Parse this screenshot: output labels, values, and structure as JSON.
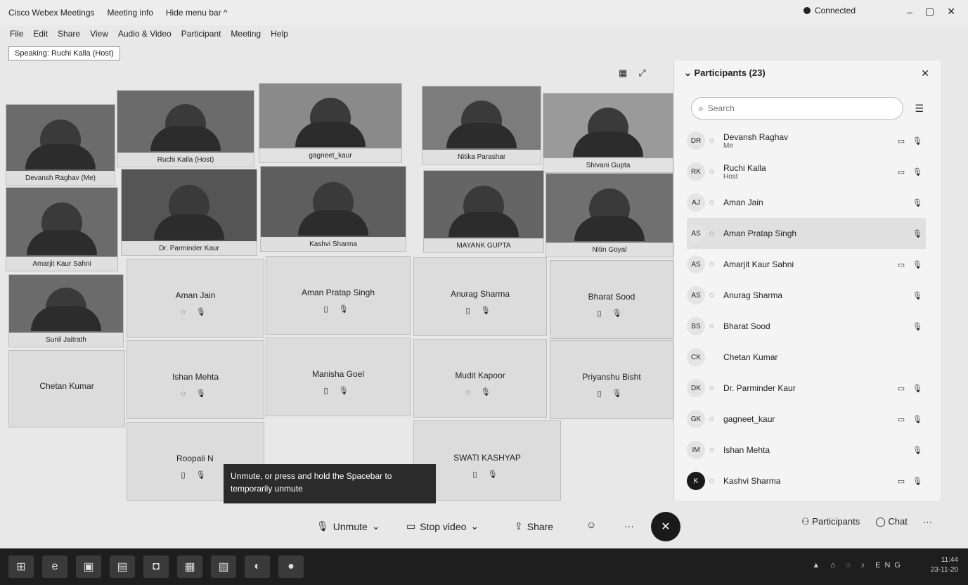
{
  "topbar": {
    "app_name": "Cisco Webex Meetings",
    "meeting_info": "Meeting info",
    "hide_menu_bar": "Hide menu bar ^",
    "connected": "Connected",
    "minimize": "–",
    "restore": "▢",
    "close": "✕"
  },
  "menu": [
    "File",
    "Edit",
    "Share",
    "View",
    "Audio & Video",
    "Participant",
    "Meeting",
    "Help"
  ],
  "speaking": "Speaking: Ruchi Kalla (Host)",
  "video_tiles": [
    {
      "label": "Devansh Raghav (Me)"
    },
    {
      "label": "Ruchi Kalla (Host)"
    },
    {
      "label": "gagneet_kaur"
    },
    {
      "label": "Nitika Parashar"
    },
    {
      "label": "Shivani Gupta"
    },
    {
      "label": "Amarjit Kaur Sahni"
    },
    {
      "label": "Dr. Parminder Kaur"
    },
    {
      "label": "Kashvi Sharma"
    },
    {
      "label": "MAYANK GUPTA"
    },
    {
      "label": "Nitin Goyal"
    },
    {
      "label": "Sunil Jaitrath"
    }
  ],
  "audio_tiles": [
    {
      "name": "Aman Jain"
    },
    {
      "name": "Aman Pratap Singh"
    },
    {
      "name": "Anurag Sharma"
    },
    {
      "name": "Bharat Sood"
    },
    {
      "name": "Chetan Kumar"
    },
    {
      "name": "Ishan Mehta"
    },
    {
      "name": "Manisha Goel"
    },
    {
      "name": "Mudit Kapoor"
    },
    {
      "name": "Priyanshu Bisht"
    },
    {
      "name": "Roopali N"
    },
    {
      "name": "SWATI KASHYAP"
    }
  ],
  "tooltip": "Unmute, or press and hold the Spacebar to temporarily unmute",
  "controls": {
    "unmute": "Unmute",
    "stop_video": "Stop video",
    "share": "Share",
    "participants": "Participants",
    "chat": "Chat",
    "more": "···",
    "end": "✕"
  },
  "panel": {
    "title": "Participants (23)",
    "search_placeholder": "Search",
    "participants": [
      {
        "initials": "DR",
        "name": "Devansh Raghav",
        "sub": "Me",
        "video": true,
        "mic": "off"
      },
      {
        "initials": "RK",
        "name": "Ruchi Kalla",
        "sub": "Host",
        "video": true,
        "mic": "on"
      },
      {
        "initials": "AJ",
        "name": "Aman Jain",
        "sub": "",
        "video": false,
        "mic": "off"
      },
      {
        "initials": "AS",
        "name": "Aman Pratap Singh",
        "sub": "",
        "video": false,
        "mic": "off"
      },
      {
        "initials": "AS",
        "name": "Amarjit Kaur Sahni",
        "sub": "",
        "video": true,
        "mic": "off"
      },
      {
        "initials": "AS",
        "name": "Anurag Sharma",
        "sub": "",
        "video": false,
        "mic": "off"
      },
      {
        "initials": "BS",
        "name": "Bharat Sood",
        "sub": "",
        "video": false,
        "mic": "off"
      },
      {
        "initials": "CK",
        "name": "Chetan Kumar",
        "sub": "",
        "video": false,
        "mic": "none"
      },
      {
        "initials": "DK",
        "name": "Dr. Parminder Kaur",
        "sub": "",
        "video": true,
        "mic": "off"
      },
      {
        "initials": "GK",
        "name": "gagneet_kaur",
        "sub": "",
        "video": true,
        "mic": "off"
      },
      {
        "initials": "IM",
        "name": "Ishan Mehta",
        "sub": "",
        "video": false,
        "mic": "off"
      },
      {
        "initials": "K",
        "name": "Kashvi Sharma",
        "sub": "",
        "video": true,
        "mic": "off"
      }
    ]
  },
  "taskbar": {
    "time": "11:44",
    "date": "23-11-20",
    "lang": "ENG"
  }
}
